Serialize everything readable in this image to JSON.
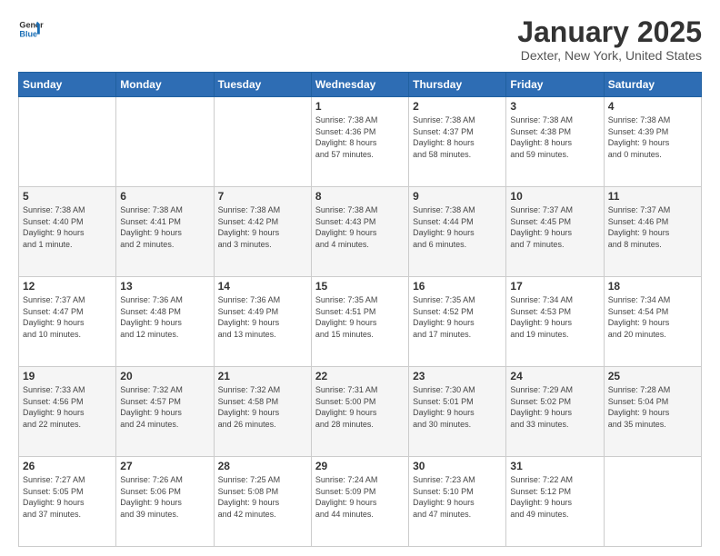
{
  "header": {
    "logo_general": "General",
    "logo_blue": "Blue",
    "title": "January 2025",
    "location": "Dexter, New York, United States"
  },
  "weekdays": [
    "Sunday",
    "Monday",
    "Tuesday",
    "Wednesday",
    "Thursday",
    "Friday",
    "Saturday"
  ],
  "weeks": [
    [
      {
        "day": "",
        "info": ""
      },
      {
        "day": "",
        "info": ""
      },
      {
        "day": "",
        "info": ""
      },
      {
        "day": "1",
        "info": "Sunrise: 7:38 AM\nSunset: 4:36 PM\nDaylight: 8 hours\nand 57 minutes."
      },
      {
        "day": "2",
        "info": "Sunrise: 7:38 AM\nSunset: 4:37 PM\nDaylight: 8 hours\nand 58 minutes."
      },
      {
        "day": "3",
        "info": "Sunrise: 7:38 AM\nSunset: 4:38 PM\nDaylight: 8 hours\nand 59 minutes."
      },
      {
        "day": "4",
        "info": "Sunrise: 7:38 AM\nSunset: 4:39 PM\nDaylight: 9 hours\nand 0 minutes."
      }
    ],
    [
      {
        "day": "5",
        "info": "Sunrise: 7:38 AM\nSunset: 4:40 PM\nDaylight: 9 hours\nand 1 minute."
      },
      {
        "day": "6",
        "info": "Sunrise: 7:38 AM\nSunset: 4:41 PM\nDaylight: 9 hours\nand 2 minutes."
      },
      {
        "day": "7",
        "info": "Sunrise: 7:38 AM\nSunset: 4:42 PM\nDaylight: 9 hours\nand 3 minutes."
      },
      {
        "day": "8",
        "info": "Sunrise: 7:38 AM\nSunset: 4:43 PM\nDaylight: 9 hours\nand 4 minutes."
      },
      {
        "day": "9",
        "info": "Sunrise: 7:38 AM\nSunset: 4:44 PM\nDaylight: 9 hours\nand 6 minutes."
      },
      {
        "day": "10",
        "info": "Sunrise: 7:37 AM\nSunset: 4:45 PM\nDaylight: 9 hours\nand 7 minutes."
      },
      {
        "day": "11",
        "info": "Sunrise: 7:37 AM\nSunset: 4:46 PM\nDaylight: 9 hours\nand 8 minutes."
      }
    ],
    [
      {
        "day": "12",
        "info": "Sunrise: 7:37 AM\nSunset: 4:47 PM\nDaylight: 9 hours\nand 10 minutes."
      },
      {
        "day": "13",
        "info": "Sunrise: 7:36 AM\nSunset: 4:48 PM\nDaylight: 9 hours\nand 12 minutes."
      },
      {
        "day": "14",
        "info": "Sunrise: 7:36 AM\nSunset: 4:49 PM\nDaylight: 9 hours\nand 13 minutes."
      },
      {
        "day": "15",
        "info": "Sunrise: 7:35 AM\nSunset: 4:51 PM\nDaylight: 9 hours\nand 15 minutes."
      },
      {
        "day": "16",
        "info": "Sunrise: 7:35 AM\nSunset: 4:52 PM\nDaylight: 9 hours\nand 17 minutes."
      },
      {
        "day": "17",
        "info": "Sunrise: 7:34 AM\nSunset: 4:53 PM\nDaylight: 9 hours\nand 19 minutes."
      },
      {
        "day": "18",
        "info": "Sunrise: 7:34 AM\nSunset: 4:54 PM\nDaylight: 9 hours\nand 20 minutes."
      }
    ],
    [
      {
        "day": "19",
        "info": "Sunrise: 7:33 AM\nSunset: 4:56 PM\nDaylight: 9 hours\nand 22 minutes."
      },
      {
        "day": "20",
        "info": "Sunrise: 7:32 AM\nSunset: 4:57 PM\nDaylight: 9 hours\nand 24 minutes."
      },
      {
        "day": "21",
        "info": "Sunrise: 7:32 AM\nSunset: 4:58 PM\nDaylight: 9 hours\nand 26 minutes."
      },
      {
        "day": "22",
        "info": "Sunrise: 7:31 AM\nSunset: 5:00 PM\nDaylight: 9 hours\nand 28 minutes."
      },
      {
        "day": "23",
        "info": "Sunrise: 7:30 AM\nSunset: 5:01 PM\nDaylight: 9 hours\nand 30 minutes."
      },
      {
        "day": "24",
        "info": "Sunrise: 7:29 AM\nSunset: 5:02 PM\nDaylight: 9 hours\nand 33 minutes."
      },
      {
        "day": "25",
        "info": "Sunrise: 7:28 AM\nSunset: 5:04 PM\nDaylight: 9 hours\nand 35 minutes."
      }
    ],
    [
      {
        "day": "26",
        "info": "Sunrise: 7:27 AM\nSunset: 5:05 PM\nDaylight: 9 hours\nand 37 minutes."
      },
      {
        "day": "27",
        "info": "Sunrise: 7:26 AM\nSunset: 5:06 PM\nDaylight: 9 hours\nand 39 minutes."
      },
      {
        "day": "28",
        "info": "Sunrise: 7:25 AM\nSunset: 5:08 PM\nDaylight: 9 hours\nand 42 minutes."
      },
      {
        "day": "29",
        "info": "Sunrise: 7:24 AM\nSunset: 5:09 PM\nDaylight: 9 hours\nand 44 minutes."
      },
      {
        "day": "30",
        "info": "Sunrise: 7:23 AM\nSunset: 5:10 PM\nDaylight: 9 hours\nand 47 minutes."
      },
      {
        "day": "31",
        "info": "Sunrise: 7:22 AM\nSunset: 5:12 PM\nDaylight: 9 hours\nand 49 minutes."
      },
      {
        "day": "",
        "info": ""
      }
    ]
  ]
}
